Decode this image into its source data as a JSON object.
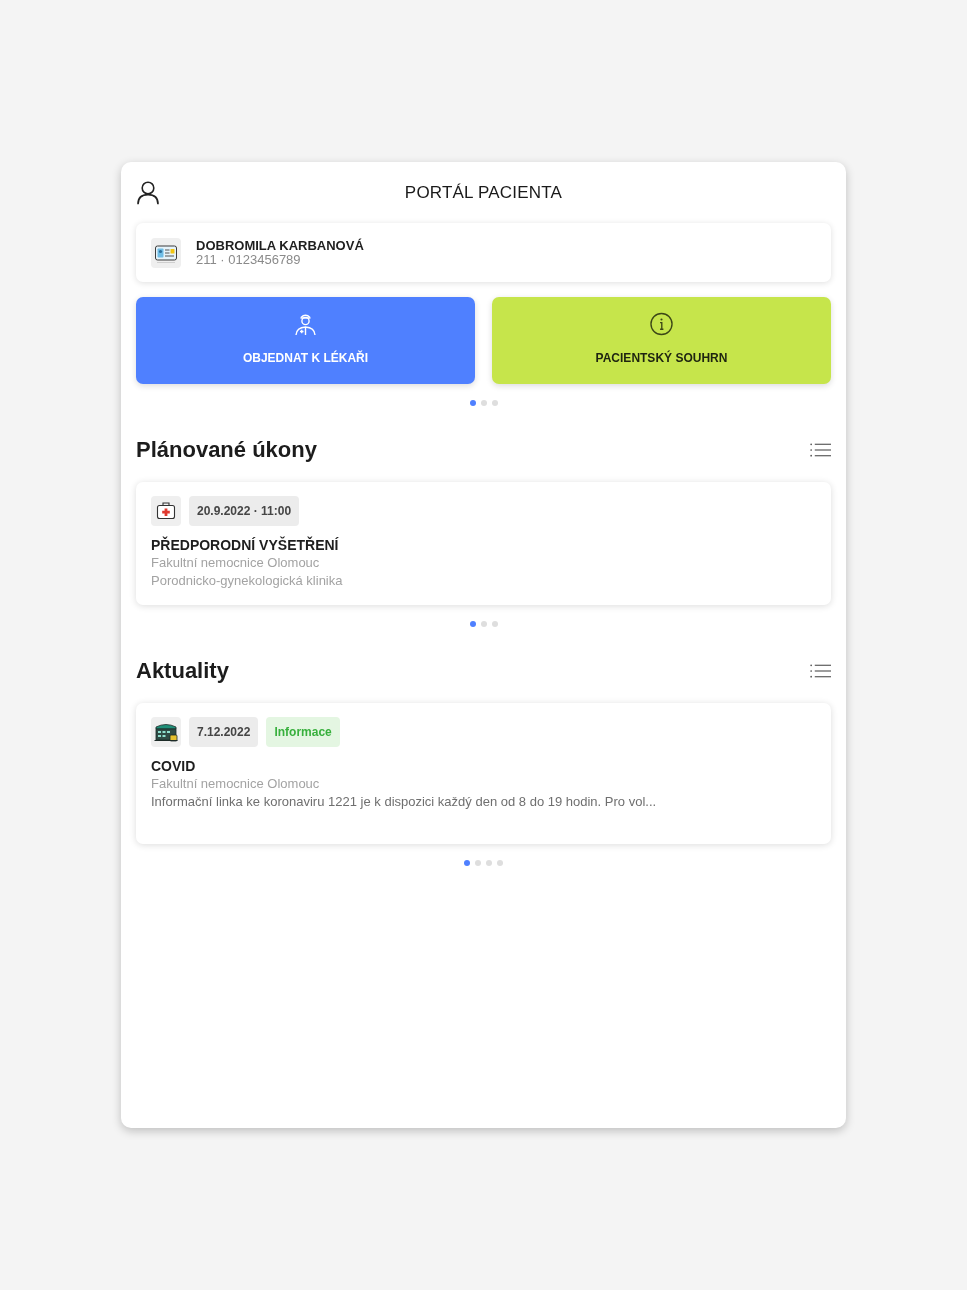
{
  "header": {
    "title": "PORTÁL PACIENTA"
  },
  "patient": {
    "name": "DOBROMILA KARBANOVÁ",
    "number": "211 · 0123456789"
  },
  "actions": [
    {
      "kind": "doctor",
      "label": "OBJEDNAT K LÉKAŘI",
      "color": "#4f80ff"
    },
    {
      "kind": "info",
      "label": "PACIENTSKÝ SOUHRN",
      "color": "#c6e54b"
    }
  ],
  "actions_pager": [
    {
      "selected": true
    },
    {
      "selected": false
    },
    {
      "selected": false
    }
  ],
  "sections": [
    {
      "title": "Plánované úkony",
      "cards": [
        {
          "kind": "medical-kit",
          "date": "20.9.2022 · 11:00",
          "title": "PŘEDPORODNÍ VYŠETŘENÍ",
          "organization": "Fakultní nemocnice Olomouc",
          "department": "Porodnicko-gynekologická klinika"
        }
      ],
      "pager": [
        {
          "selected": true
        },
        {
          "selected": false
        },
        {
          "selected": false
        }
      ]
    },
    {
      "title": "Aktuality",
      "cards": [
        {
          "kind": "hospital",
          "date": "7.12.2022",
          "tag": "Informace",
          "title": "COVID",
          "organization": "Fakultní nemocnice Olomouc",
          "text": "Informační linka ke koronaviru 1221 je k dispozici každý den od 8 do 19 hodin. Pro vol..."
        }
      ],
      "pager": [
        {
          "selected": true
        },
        {
          "selected": false
        },
        {
          "selected": false
        },
        {
          "selected": false
        }
      ]
    }
  ]
}
